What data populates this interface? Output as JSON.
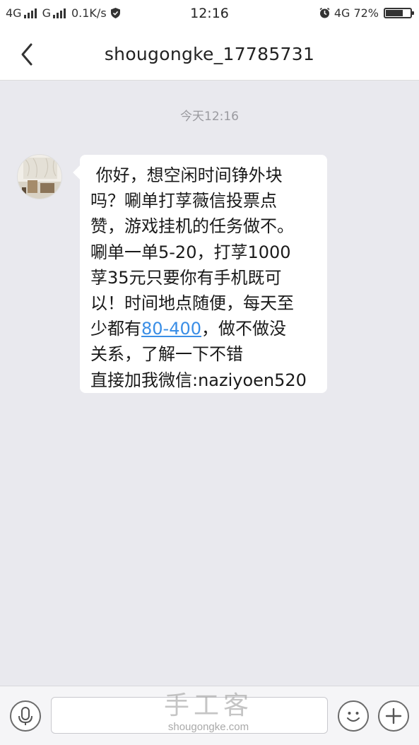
{
  "status_bar": {
    "network1": "4G",
    "network2": "G",
    "speed": "0.1K/s",
    "time": "12:16",
    "network_right": "4G",
    "battery": "72%",
    "battery_level": 0.72
  },
  "header": {
    "title": "shougongke_17785731"
  },
  "conversation": {
    "timestamp": "今天12:16",
    "message_lines": [
      " 你好，想空闲时间铮外块",
      "吗？唰单打莩薇信投票点",
      "赞，游戏挂机的任务做不。",
      "唰单一单5-20，打莩1000",
      "莩35元只要你有手机既可",
      "以！时间地点随便，每天至"
    ],
    "line7_before": "少都有",
    "line7_link": "80-400",
    "line7_after": "，做不做没",
    "line8": "关系，了解一下不错",
    "line9": "直接加我微信:naziyoen520"
  },
  "input_bar": {
    "placeholder": ""
  },
  "watermark": {
    "logo": "手工客",
    "url": "shougongke.com"
  }
}
